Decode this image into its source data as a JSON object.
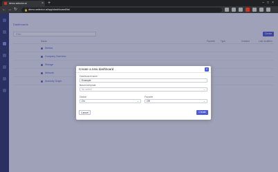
{
  "browser": {
    "tab_title": "demo.selector.ai",
    "tab_close": "×",
    "new_tab": "+",
    "window_controls": "–□×",
    "back": "←",
    "forward": "→",
    "reload": "↻",
    "url": "demo.selector.ai/app/dashboard/list",
    "lock": "🔒",
    "extension_colors": [
      "#9aa0a6",
      "#9aa0a6",
      "#9aa0a6",
      "#d93025",
      "#9aa0a6",
      "#9aa0a6",
      "#9aa0a6"
    ]
  },
  "app": {
    "breadcrumb": "Dashboards",
    "filter_placeholder": "Filter",
    "create_button": "Create",
    "columns": [
      "Name",
      "Favorite",
      "Type",
      "Created",
      "Last modified"
    ],
    "rows": [
      {
        "name": "Metrics"
      },
      {
        "name": "Company Overview"
      },
      {
        "name": "Storage"
      },
      {
        "name": "Network"
      },
      {
        "name": "Anomaly Graph"
      }
    ]
  },
  "modal": {
    "title": "Create a new dashboard",
    "close_icon": "×",
    "name_label": "Dashboard name",
    "name_value": "Example",
    "based_on_label": "Based template",
    "based_on_placeholder": "No select",
    "global_label": "Global",
    "global_value": "On",
    "favorite_label": "Favorite",
    "favorite_value": "Off",
    "select_arrow": "⌄",
    "cancel_label": "Cancel",
    "create_label": "Create"
  },
  "colors": {
    "accent": "#4f5bd5",
    "sidebar": "#2d3464",
    "overlay": "#262d5a"
  }
}
